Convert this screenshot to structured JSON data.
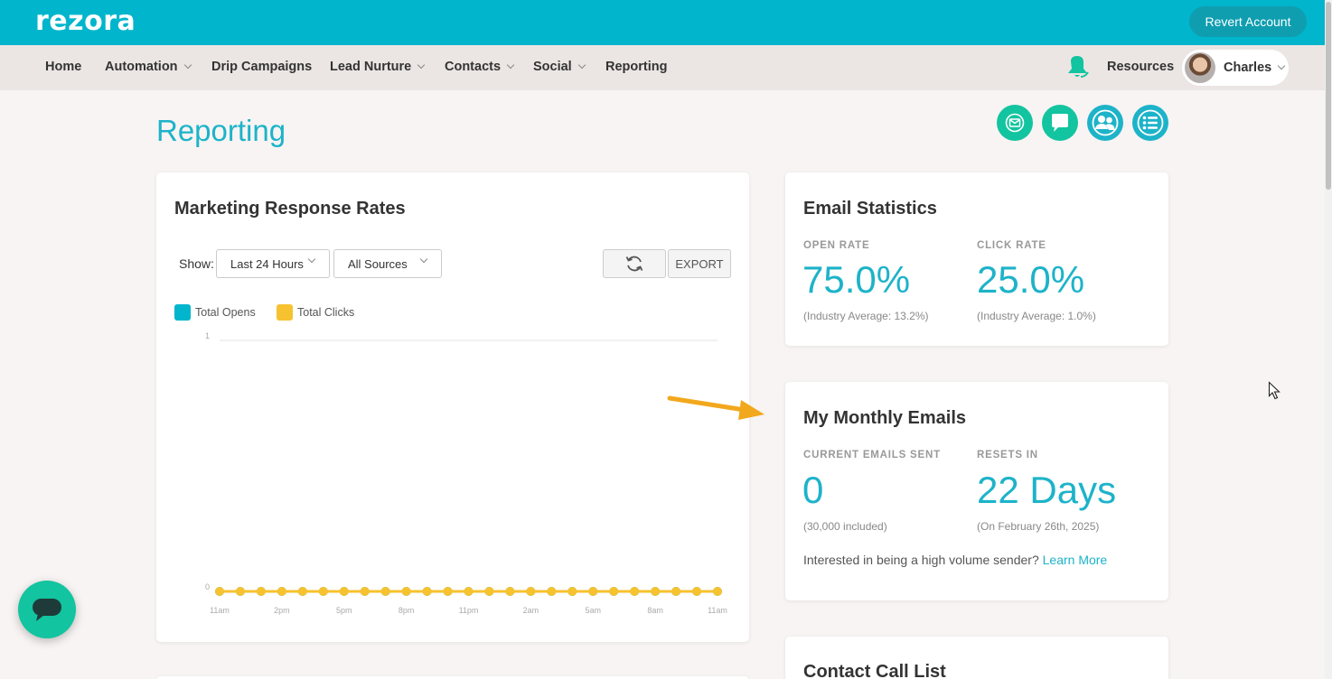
{
  "brand": {
    "logo": "rezora",
    "accent": "#00b5cc",
    "teal_text": "#1db3c9"
  },
  "header": {
    "revert_label": "Revert Account"
  },
  "nav": {
    "items": [
      "Home",
      "Automation",
      "Drip Campaigns",
      "Lead Nurture",
      "Contacts",
      "Social",
      "Reporting"
    ],
    "resources": "Resources",
    "user": "Charles"
  },
  "page": {
    "title": "Reporting"
  },
  "icons": [
    "email-icon",
    "chat-icon",
    "contacts-icon",
    "list-icon",
    "refresh-icon",
    "bell-icon"
  ],
  "response_card": {
    "title": "Marketing Response Rates",
    "show_label": "Show:",
    "period": "Last 24 Hours",
    "source": "All Sources",
    "export_label": "EXPORT",
    "legend": [
      {
        "label": "Total Opens",
        "color": "#00b5cc"
      },
      {
        "label": "Total Clicks",
        "color": "#f7c22f"
      }
    ]
  },
  "chart_data": {
    "type": "line",
    "x": [
      "11am",
      "12pm",
      "1pm",
      "2pm",
      "3pm",
      "4pm",
      "5pm",
      "6pm",
      "7pm",
      "8pm",
      "9pm",
      "10pm",
      "11pm",
      "12am",
      "1am",
      "2am",
      "3am",
      "4am",
      "5am",
      "6am",
      "7am",
      "8am",
      "9am",
      "10am",
      "11am"
    ],
    "tick_labels": [
      "11am",
      "2pm",
      "5pm",
      "8pm",
      "11pm",
      "2am",
      "5am",
      "8am",
      "11am"
    ],
    "tick_every": 3,
    "series": [
      {
        "name": "Total Opens",
        "color": "#00b5cc",
        "values": [
          0,
          0,
          0,
          0,
          0,
          0,
          0,
          0,
          0,
          0,
          0,
          0,
          0,
          0,
          0,
          0,
          0,
          0,
          0,
          0,
          0,
          0,
          0,
          0,
          0
        ]
      },
      {
        "name": "Total Clicks",
        "color": "#f7c22f",
        "values": [
          0,
          0,
          0,
          0,
          0,
          0,
          0,
          0,
          0,
          0,
          0,
          0,
          0,
          0,
          0,
          0,
          0,
          0,
          0,
          0,
          0,
          0,
          0,
          0,
          0
        ]
      }
    ],
    "ylim": [
      0,
      1
    ],
    "yticks": [
      "0",
      "1"
    ],
    "grid": true
  },
  "email_stats": {
    "title": "Email Statistics",
    "open_label": "OPEN RATE",
    "open_value": "75.0%",
    "open_sub": "(Industry Average: 13.2%)",
    "click_label": "CLICK RATE",
    "click_value": "25.0%",
    "click_sub": "(Industry Average: 1.0%)"
  },
  "monthly": {
    "title": "My Monthly Emails",
    "sent_label": "CURRENT EMAILS SENT",
    "sent_value": "0",
    "sent_sub": "(30,000 included)",
    "reset_label": "RESETS IN",
    "reset_value": "22 Days",
    "reset_sub": "(On February 26th, 2025)",
    "high_volume_text": "Interested in being a high volume sender?",
    "learn_more": "Learn More"
  },
  "call_list": {
    "title": "Contact Call List"
  }
}
